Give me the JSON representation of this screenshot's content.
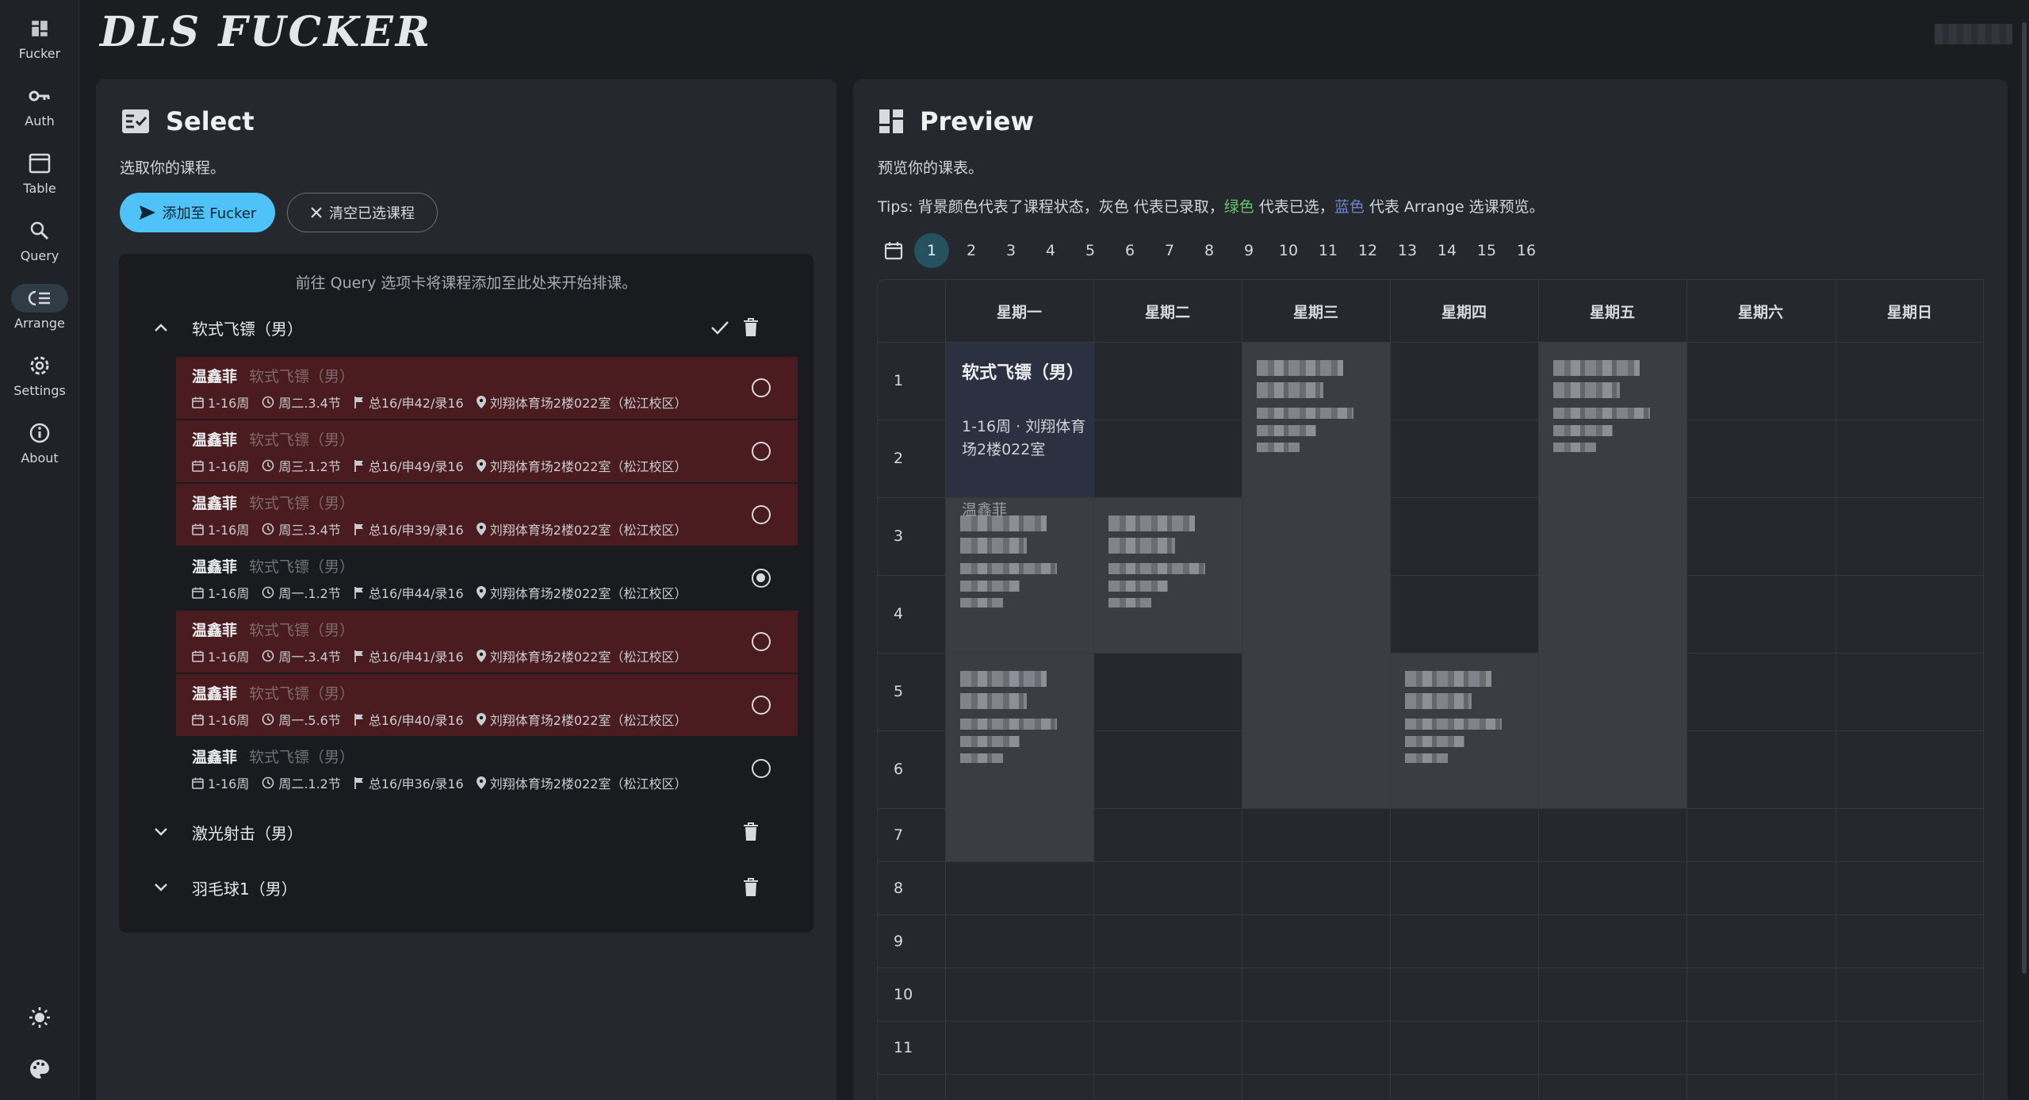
{
  "app": {
    "logo": "DLS FUCKER"
  },
  "sidebar": {
    "items": [
      {
        "label": "Fucker",
        "icon": "layout-icon"
      },
      {
        "label": "Auth",
        "icon": "key-icon"
      },
      {
        "label": "Table",
        "icon": "window-icon"
      },
      {
        "label": "Query",
        "icon": "search-icon"
      },
      {
        "label": "Arrange",
        "icon": "list-icon",
        "active": true
      },
      {
        "label": "Settings",
        "icon": "gear-icon"
      },
      {
        "label": "About",
        "icon": "info-icon"
      }
    ],
    "bottom": [
      {
        "icon": "theme-sun-icon"
      },
      {
        "icon": "palette-icon"
      }
    ]
  },
  "select": {
    "title": "Select",
    "subtitle": "选取你的课程。",
    "add_button": "添加至 Fucker",
    "clear_button": "清空已选课程",
    "hint": "前往 Query 选项卡将课程添加至此处来开始排课。",
    "groups": [
      {
        "name": "软式飞镖（男）",
        "expanded": true,
        "options": [
          {
            "teacher": "温鑫菲",
            "course": "软式飞镖（男）",
            "weeks": "1-16周",
            "time": "周二.3.4节",
            "quota": "总16/申42/录16",
            "place": "刘翔体育场2楼022室（松江校区）",
            "conflict": true,
            "selected": false
          },
          {
            "teacher": "温鑫菲",
            "course": "软式飞镖（男）",
            "weeks": "1-16周",
            "time": "周三.1.2节",
            "quota": "总16/申49/录16",
            "place": "刘翔体育场2楼022室（松江校区）",
            "conflict": true,
            "selected": false
          },
          {
            "teacher": "温鑫菲",
            "course": "软式飞镖（男）",
            "weeks": "1-16周",
            "time": "周三.3.4节",
            "quota": "总16/申39/录16",
            "place": "刘翔体育场2楼022室（松江校区）",
            "conflict": true,
            "selected": false
          },
          {
            "teacher": "温鑫菲",
            "course": "软式飞镖（男）",
            "weeks": "1-16周",
            "time": "周一.1.2节",
            "quota": "总16/申44/录16",
            "place": "刘翔体育场2楼022室（松江校区）",
            "conflict": false,
            "selected": true
          },
          {
            "teacher": "温鑫菲",
            "course": "软式飞镖（男）",
            "weeks": "1-16周",
            "time": "周一.3.4节",
            "quota": "总16/申41/录16",
            "place": "刘翔体育场2楼022室（松江校区）",
            "conflict": true,
            "selected": false
          },
          {
            "teacher": "温鑫菲",
            "course": "软式飞镖（男）",
            "weeks": "1-16周",
            "time": "周一.5.6节",
            "quota": "总16/申40/录16",
            "place": "刘翔体育场2楼022室（松江校区）",
            "conflict": true,
            "selected": false
          },
          {
            "teacher": "温鑫菲",
            "course": "软式飞镖（男）",
            "weeks": "1-16周",
            "time": "周二.1.2节",
            "quota": "总16/申36/录16",
            "place": "刘翔体育场2楼022室（松江校区）",
            "conflict": false,
            "selected": false
          }
        ]
      },
      {
        "name": "激光射击（男）",
        "expanded": false
      },
      {
        "name": "羽毛球1（男）",
        "expanded": false
      }
    ]
  },
  "preview": {
    "title": "Preview",
    "subtitle": "预览你的课表。",
    "tips": {
      "prefix": "Tips: 背景颜色代表了课程状态，灰色 代表已录取，",
      "green": "绿色",
      "mid": " 代表已选，",
      "blue": "蓝色",
      "suffix": " 代表 Arrange 选课预览。",
      "green_color": "#69c36f",
      "blue_color": "#6b86cf"
    },
    "weeks": [
      "1",
      "2",
      "3",
      "4",
      "5",
      "6",
      "7",
      "8",
      "9",
      "10",
      "11",
      "12",
      "13",
      "14",
      "15",
      "16"
    ],
    "active_week": "1",
    "days": [
      "星期一",
      "星期二",
      "星期三",
      "星期四",
      "星期五",
      "星期六",
      "星期日"
    ],
    "periods": [
      "1",
      "2",
      "3",
      "4",
      "5",
      "6",
      "7",
      "8",
      "9",
      "10",
      "11"
    ],
    "selected_block": {
      "title": "软式飞镖（男）",
      "info": "1-16周 · 刘翔体育场2楼022室",
      "teacher": "温鑫菲"
    }
  }
}
